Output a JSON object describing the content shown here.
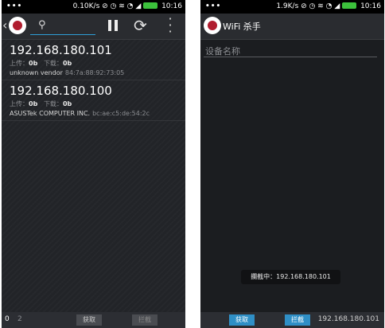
{
  "left": {
    "status": {
      "dots": "•••",
      "speed": "0.10K/s",
      "icons": "⊘ ◷ ≋ ◔ ◢",
      "time": "10:16"
    },
    "devices": [
      {
        "ip": "192.168.180.101",
        "up_label": "上传：",
        "up": "0b",
        "down_label": "下载：",
        "down": "0b",
        "vendor": "unknown vendor",
        "mac": "84:7a:88:92:73:05"
      },
      {
        "ip": "192.168.180.100",
        "up_label": "上传：",
        "up": "0b",
        "down_label": "下载：",
        "down": "0b",
        "vendor": "ASUSTek COMPUTER INC.",
        "mac": "bc:ae:c5:de:54:2c"
      }
    ],
    "bottom": {
      "count_a": "0",
      "count_b": "2",
      "capture": "获取",
      "block": "拦截"
    }
  },
  "right": {
    "status": {
      "dots": "•••",
      "speed": "1.9K/s",
      "icons": "⊘ ◷ ≋ ◔ ◢",
      "time": "10:16"
    },
    "title": "WiFi 杀手",
    "name_placeholder": "设备名称",
    "toast": "攔截中：192.168.180.101",
    "bottom": {
      "capture": "获取",
      "block": "拦截",
      "ip": "192.168.180.101"
    }
  },
  "colors": {
    "accent": "#2f9fd8",
    "brand_red": "#b01c2e",
    "background": "#202226"
  },
  "icons": {
    "search": "search-icon",
    "pause": "pause-icon",
    "refresh": "refresh-icon",
    "menu": "more-vert-icon"
  }
}
